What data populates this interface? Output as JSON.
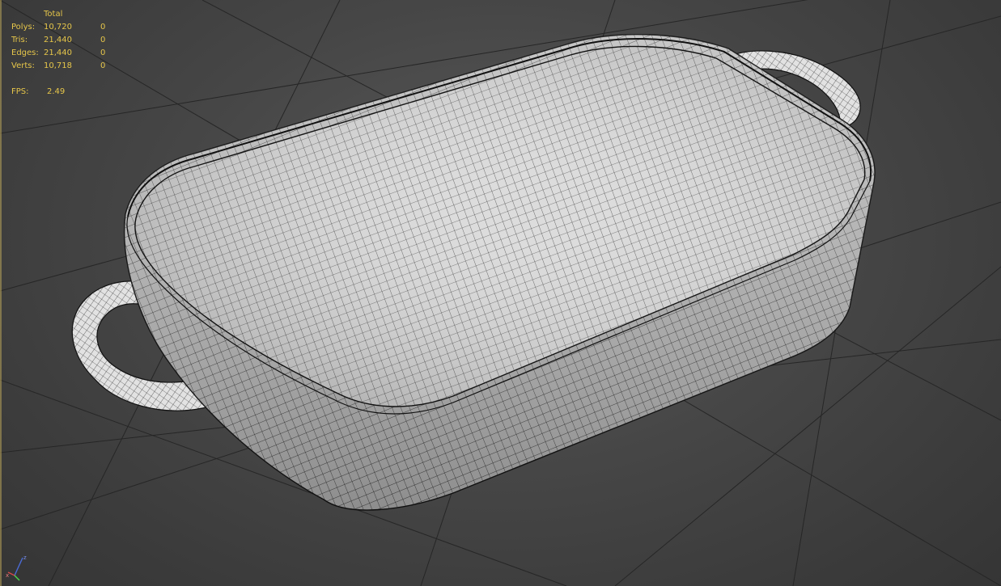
{
  "viewport_stats": {
    "header": "Total",
    "rows": [
      {
        "label": "Polys:",
        "total": "10,720",
        "selected": "0"
      },
      {
        "label": "Tris:",
        "total": "21,440",
        "selected": "0"
      },
      {
        "label": "Edges:",
        "total": "21,440",
        "selected": "0"
      },
      {
        "label": "Verts:",
        "total": "10,718",
        "selected": "0"
      }
    ],
    "fps_label": "FPS:",
    "fps_value": "2.49"
  },
  "axis_gizmo": {
    "x": "x",
    "z": "z"
  },
  "colors": {
    "stats_text": "#e6c64a",
    "viewport_bg": "#474747",
    "grid_line": "#262626",
    "mesh_fill": "#d8d8d8",
    "wire": "#1a1a1a"
  }
}
